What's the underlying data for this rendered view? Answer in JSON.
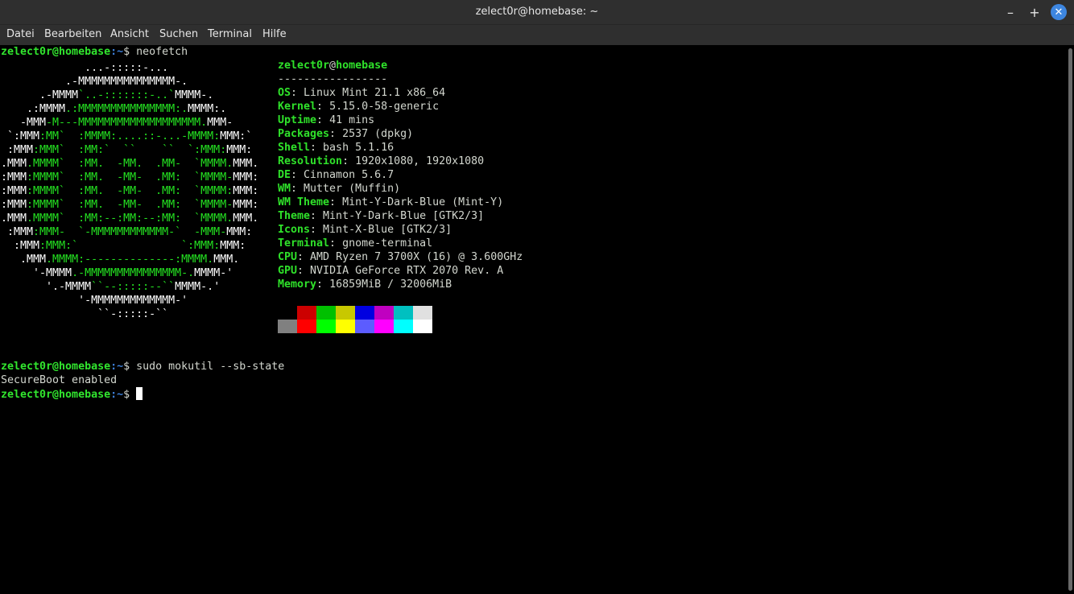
{
  "window": {
    "title": "zelect0r@homebase: ~",
    "min_glyph": "–",
    "max_glyph": "+",
    "close_glyph": "✕"
  },
  "menu": [
    "Datei",
    "Bearbeiten",
    "Ansicht",
    "Suchen",
    "Terminal",
    "Hilfe"
  ],
  "prompt": {
    "user_host": "zelect0r@homebase",
    "path": ":~",
    "symbol": "$ "
  },
  "commands": {
    "first": "neofetch",
    "second": "sudo mokutil --sb-state",
    "second_output": "SecureBoot enabled"
  },
  "neofetch": {
    "header_user": "zelect0r",
    "header_at": "@",
    "header_host": "homebase",
    "separator": "-----------------",
    "info": [
      {
        "key": "OS",
        "value": "Linux Mint 21.1 x86_64"
      },
      {
        "key": "Kernel",
        "value": "5.15.0-58-generic"
      },
      {
        "key": "Uptime",
        "value": "41 mins"
      },
      {
        "key": "Packages",
        "value": "2537 (dpkg)"
      },
      {
        "key": "Shell",
        "value": "bash 5.1.16"
      },
      {
        "key": "Resolution",
        "value": "1920x1080, 1920x1080"
      },
      {
        "key": "DE",
        "value": "Cinnamon 5.6.7"
      },
      {
        "key": "WM",
        "value": "Mutter (Muffin)"
      },
      {
        "key": "WM Theme",
        "value": "Mint-Y-Dark-Blue (Mint-Y)"
      },
      {
        "key": "Theme",
        "value": "Mint-Y-Dark-Blue [GTK2/3]"
      },
      {
        "key": "Icons",
        "value": "Mint-X-Blue [GTK2/3]"
      },
      {
        "key": "Terminal",
        "value": "gnome-terminal"
      },
      {
        "key": "CPU",
        "value": "AMD Ryzen 7 3700X (16) @ 3.600GHz"
      },
      {
        "key": "GPU",
        "value": "NVIDIA GeForce RTX 2070 Rev. A"
      },
      {
        "key": "Memory",
        "value": "16859MiB / 32006MiB"
      }
    ],
    "palette_top": [
      "#000000",
      "#cc0000",
      "#00c000",
      "#c8c800",
      "#0000e0",
      "#c000c0",
      "#00c0c0",
      "#e0e0e0"
    ],
    "palette_bottom": [
      "#808080",
      "#ff0000",
      "#00ff00",
      "#ffff00",
      "#5c5cff",
      "#ff00ff",
      "#00ffff",
      "#ffffff"
    ],
    "logo_ascii": [
      [
        [
          "w",
          "             ...-:::::-..."
        ]
      ],
      [
        [
          "w",
          "          .-MMMMMMMMMMMMMMM-."
        ]
      ],
      [
        [
          "w",
          "      .-MMMM"
        ],
        [
          "g",
          "`..-:::::::-..`"
        ],
        [
          "w",
          "MMMM-."
        ]
      ],
      [
        [
          "w",
          "    .:MMMM"
        ],
        [
          "g",
          ".:MMMMMMMMMMMMMMM:."
        ],
        [
          "w",
          "MMMM:."
        ]
      ],
      [
        [
          "w",
          "   -MMM"
        ],
        [
          "g",
          "-M---MMMMMMMMMMMMMMMMMMM."
        ],
        [
          "w",
          "MMM-"
        ]
      ],
      [
        [
          "w",
          " `:MMM"
        ],
        [
          "g",
          ":MM`  :MMMM:....::-...-MMMM:"
        ],
        [
          "w",
          "MMM:`"
        ]
      ],
      [
        [
          "w",
          " :MMM"
        ],
        [
          "g",
          ":MMM`  :MM:`  ``    ``  `:MMM:"
        ],
        [
          "w",
          "MMM:"
        ]
      ],
      [
        [
          "w",
          ".MMM"
        ],
        [
          "g",
          ".MMMM`  :MM.  -MM.  .MM-  `MMMM."
        ],
        [
          "w",
          "MMM."
        ]
      ],
      [
        [
          "w",
          ":MMM"
        ],
        [
          "g",
          ":MMMM`  :MM.  -MM-  .MM:  `MMMM-"
        ],
        [
          "w",
          "MMM:"
        ]
      ],
      [
        [
          "w",
          ":MMM"
        ],
        [
          "g",
          ":MMMM`  :MM.  -MM-  .MM:  `MMMM:"
        ],
        [
          "w",
          "MMM:"
        ]
      ],
      [
        [
          "w",
          ":MMM"
        ],
        [
          "g",
          ":MMMM`  :MM.  -MM-  .MM:  `MMMM-"
        ],
        [
          "w",
          "MMM:"
        ]
      ],
      [
        [
          "w",
          ".MMM"
        ],
        [
          "g",
          ".MMMM`  :MM:--:MM:--:MM:  `MMMM."
        ],
        [
          "w",
          "MMM."
        ]
      ],
      [
        [
          "w",
          " :MMM"
        ],
        [
          "g",
          ":MMM-  `-MMMMMMMMMMMM-`  -MMM-"
        ],
        [
          "w",
          "MMM:"
        ]
      ],
      [
        [
          "w",
          "  :MMM"
        ],
        [
          "g",
          ":MMM:`                `:MMM:"
        ],
        [
          "w",
          "MMM:"
        ]
      ],
      [
        [
          "w",
          "   .MMM"
        ],
        [
          "g",
          ".MMMM:--------------:MMMM."
        ],
        [
          "w",
          "MMM."
        ]
      ],
      [
        [
          "w",
          "     '-MMMM"
        ],
        [
          "g",
          ".-MMMMMMMMMMMMMMM-."
        ],
        [
          "w",
          "MMMM-'"
        ]
      ],
      [
        [
          "w",
          "       '.-MMMM"
        ],
        [
          "g",
          "``--:::::--``"
        ],
        [
          "w",
          "MMMM-.'"
        ]
      ],
      [
        [
          "w",
          "            '-MMMMMMMMMMMMM-'"
        ]
      ],
      [
        [
          "w",
          "               ``-:::::-``"
        ]
      ]
    ]
  },
  "colors": {
    "titlebar": "#2f2f2f",
    "close_button": "#3d86e0",
    "prompt_green": "#31e52e",
    "prompt_blue": "#3c7ed6",
    "logo_green": "#24e021"
  }
}
